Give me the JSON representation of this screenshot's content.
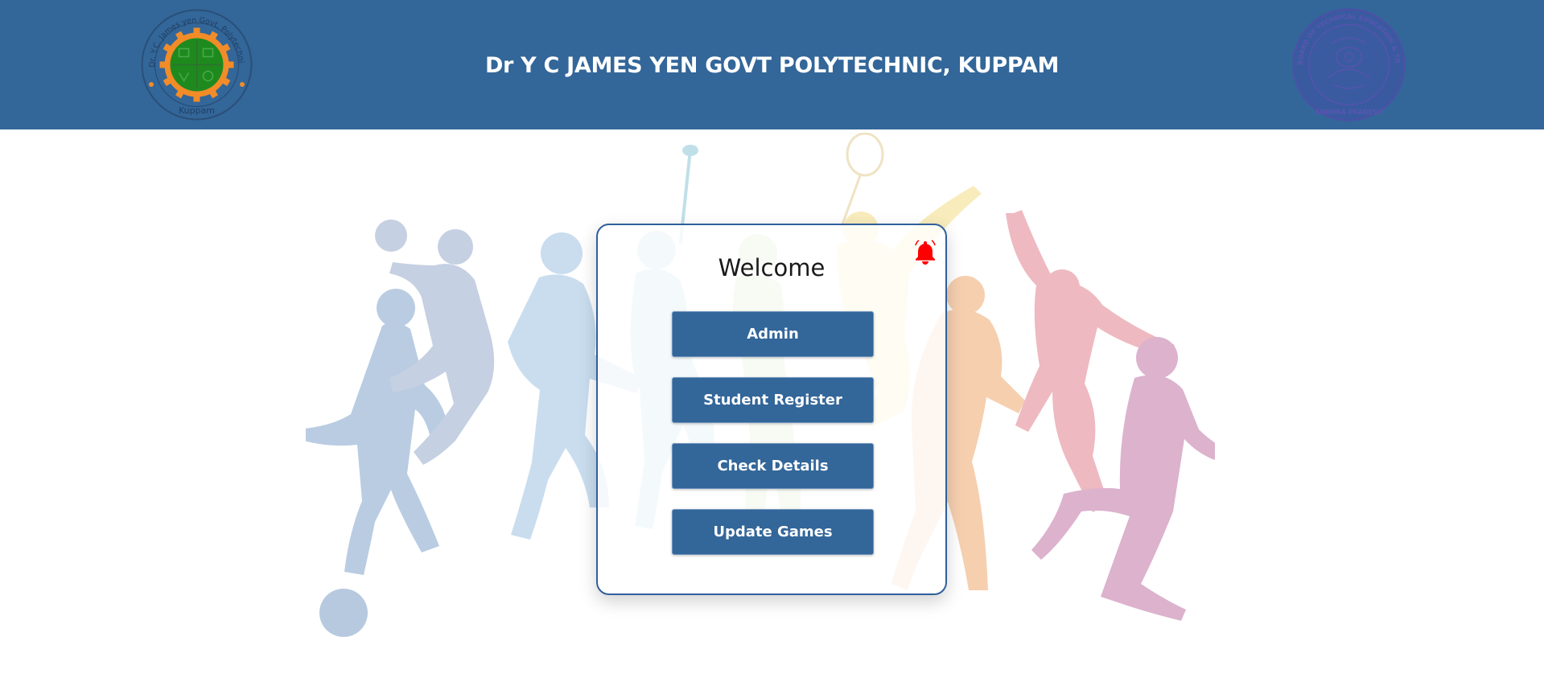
{
  "header": {
    "title": "Dr Y C JAMES YEN GOVT POLYTECHNIC, KUPPAM",
    "background_color": "#336699",
    "left_logo": {
      "icon": "college-emblem-logo",
      "ring_text": "Dr. Y.C. James yen Govt. Polytechnic",
      "bottom_text": "Kuppam"
    },
    "right_logo": {
      "icon": "state-board-seal-logo",
      "ring_text": "STATE BOARD OF TECHNICAL EDUCATION & TRAINING",
      "bottom_text": "ANDHRA PRADESH"
    }
  },
  "background": {
    "icon": "sports-silhouettes-illustration"
  },
  "welcome_card": {
    "title": "Welcome",
    "notification_icon": "bell-icon",
    "notification_color": "#ff0000",
    "buttons": [
      {
        "label": "Admin"
      },
      {
        "label": "Student Register"
      },
      {
        "label": "Check Details"
      },
      {
        "label": "Update Games"
      }
    ],
    "border_color": "#2f5f9b",
    "button_color": "#336699"
  }
}
